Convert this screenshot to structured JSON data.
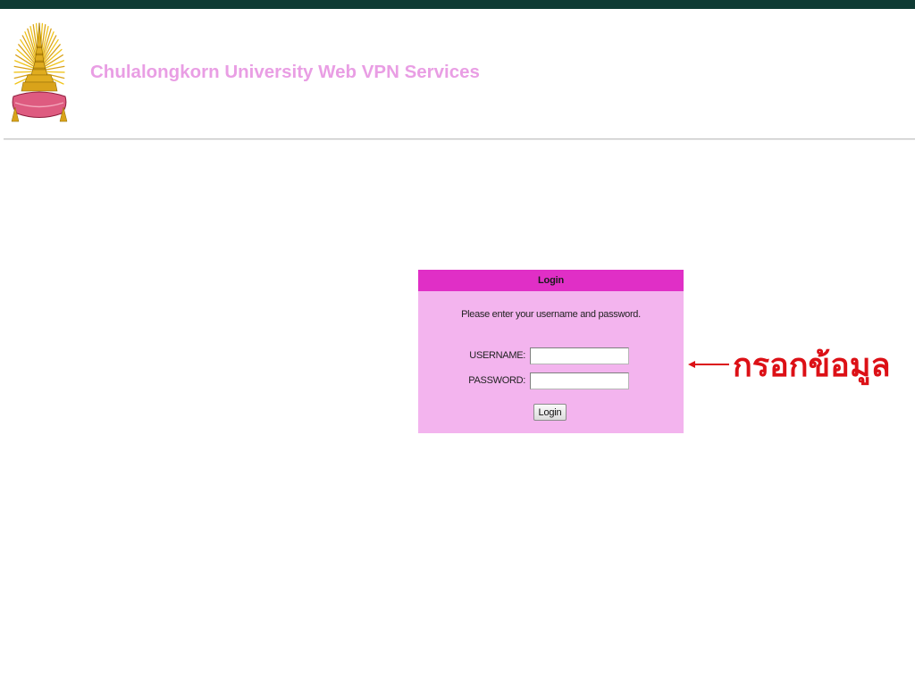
{
  "header": {
    "logo_icon": "university-emblem-icon",
    "title": "Chulalongkorn University Web VPN Services"
  },
  "login": {
    "heading": "Login",
    "instructions": "Please enter your username and password.",
    "username": {
      "label": "USERNAME:",
      "value": ""
    },
    "password": {
      "label": "PASSWORD:",
      "value": ""
    },
    "submit_label": "Login"
  },
  "annotation": {
    "arrow_icon": "left-arrow-icon",
    "text": "กรอกข้อมูล"
  },
  "colors": {
    "top_bar": "#0f3b34",
    "title": "#e99ee4",
    "login_header": "#e02fc6",
    "login_body": "#f3b4ee",
    "annotation": "#dc1016",
    "divider": "#c4c4c4"
  }
}
